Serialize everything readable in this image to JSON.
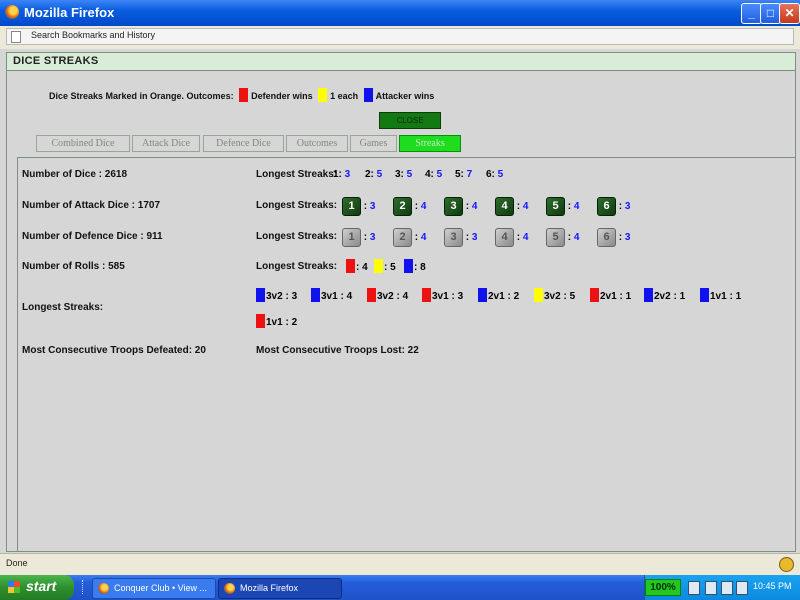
{
  "window": {
    "title": "Mozilla Firefox"
  },
  "sidebar_search": {
    "label": "Search Bookmarks and History"
  },
  "panel": {
    "title": "DICE STREAKS",
    "legend": {
      "intro": "Dice Streaks Marked in Orange. Outcomes:",
      "defender": "Defender wins",
      "each": "1 each",
      "attacker": "Attacker wins"
    },
    "close_label": "CLOSE",
    "tabs": [
      "Combined Dice",
      "Attack Dice",
      "Defence Dice",
      "Outcomes",
      "Games",
      "Streaks"
    ]
  },
  "stats": {
    "num_dice": "Number of Dice : 2618",
    "num_attack": "Number of Attack Dice : 1707",
    "num_defence": "Number of Defence Dice : 911",
    "num_rolls": "Number of Rolls : 585",
    "longest_streaks_label": "Longest Streaks:",
    "longest_streaks_row_label": "Longest Streaks:",
    "most_defeated": "Most Consecutive Troops Defeated: 20",
    "most_lost": "Most Consecutive Troops Lost: 22"
  },
  "combined_streaks": [
    {
      "face": "1",
      "value": "3"
    },
    {
      "face": "2",
      "value": "5"
    },
    {
      "face": "3",
      "value": "5"
    },
    {
      "face": "4",
      "value": "5"
    },
    {
      "face": "5",
      "value": "7"
    },
    {
      "face": "6",
      "value": "5"
    }
  ],
  "attack_streaks": [
    {
      "face": "1",
      "value": "3"
    },
    {
      "face": "2",
      "value": "4"
    },
    {
      "face": "3",
      "value": "4"
    },
    {
      "face": "4",
      "value": "4"
    },
    {
      "face": "5",
      "value": "4"
    },
    {
      "face": "6",
      "value": "3"
    }
  ],
  "defence_streaks": [
    {
      "face": "1",
      "value": "3"
    },
    {
      "face": "2",
      "value": "4"
    },
    {
      "face": "3",
      "value": "3"
    },
    {
      "face": "4",
      "value": "4"
    },
    {
      "face": "5",
      "value": "4"
    },
    {
      "face": "6",
      "value": "3"
    }
  ],
  "outcome_streaks": [
    {
      "color": "#ee1111",
      "value": "4"
    },
    {
      "color": "#ffff00",
      "value": "5"
    },
    {
      "color": "#1111ee",
      "value": "8"
    }
  ],
  "matchup_streaks": [
    {
      "color": "#1111ee",
      "label": "3v2 : 3"
    },
    {
      "color": "#1111ee",
      "label": "3v1 : 4"
    },
    {
      "color": "#ee1111",
      "label": "3v2 : 4"
    },
    {
      "color": "#ee1111",
      "label": "3v1 : 3"
    },
    {
      "color": "#1111ee",
      "label": "2v1 : 2"
    },
    {
      "color": "#ffff00",
      "label": "3v2 : 5"
    },
    {
      "color": "#ee1111",
      "label": "2v1 : 1"
    },
    {
      "color": "#1111ee",
      "label": "2v2 : 1"
    },
    {
      "color": "#1111ee",
      "label": "1v1 : 1"
    },
    {
      "color": "#ee1111",
      "label": "1v1 : 2"
    }
  ],
  "colors": {
    "defender": "#ee1111",
    "each": "#ffff00",
    "attacker": "#1111ee",
    "active_tab": "#1edc1e"
  },
  "status": {
    "text": "Done"
  },
  "taskbar": {
    "start": "start",
    "buttons": [
      "Conquer Club • View ...",
      "Mozilla Firefox"
    ],
    "battery": "100%",
    "clock": "10:45 PM"
  }
}
